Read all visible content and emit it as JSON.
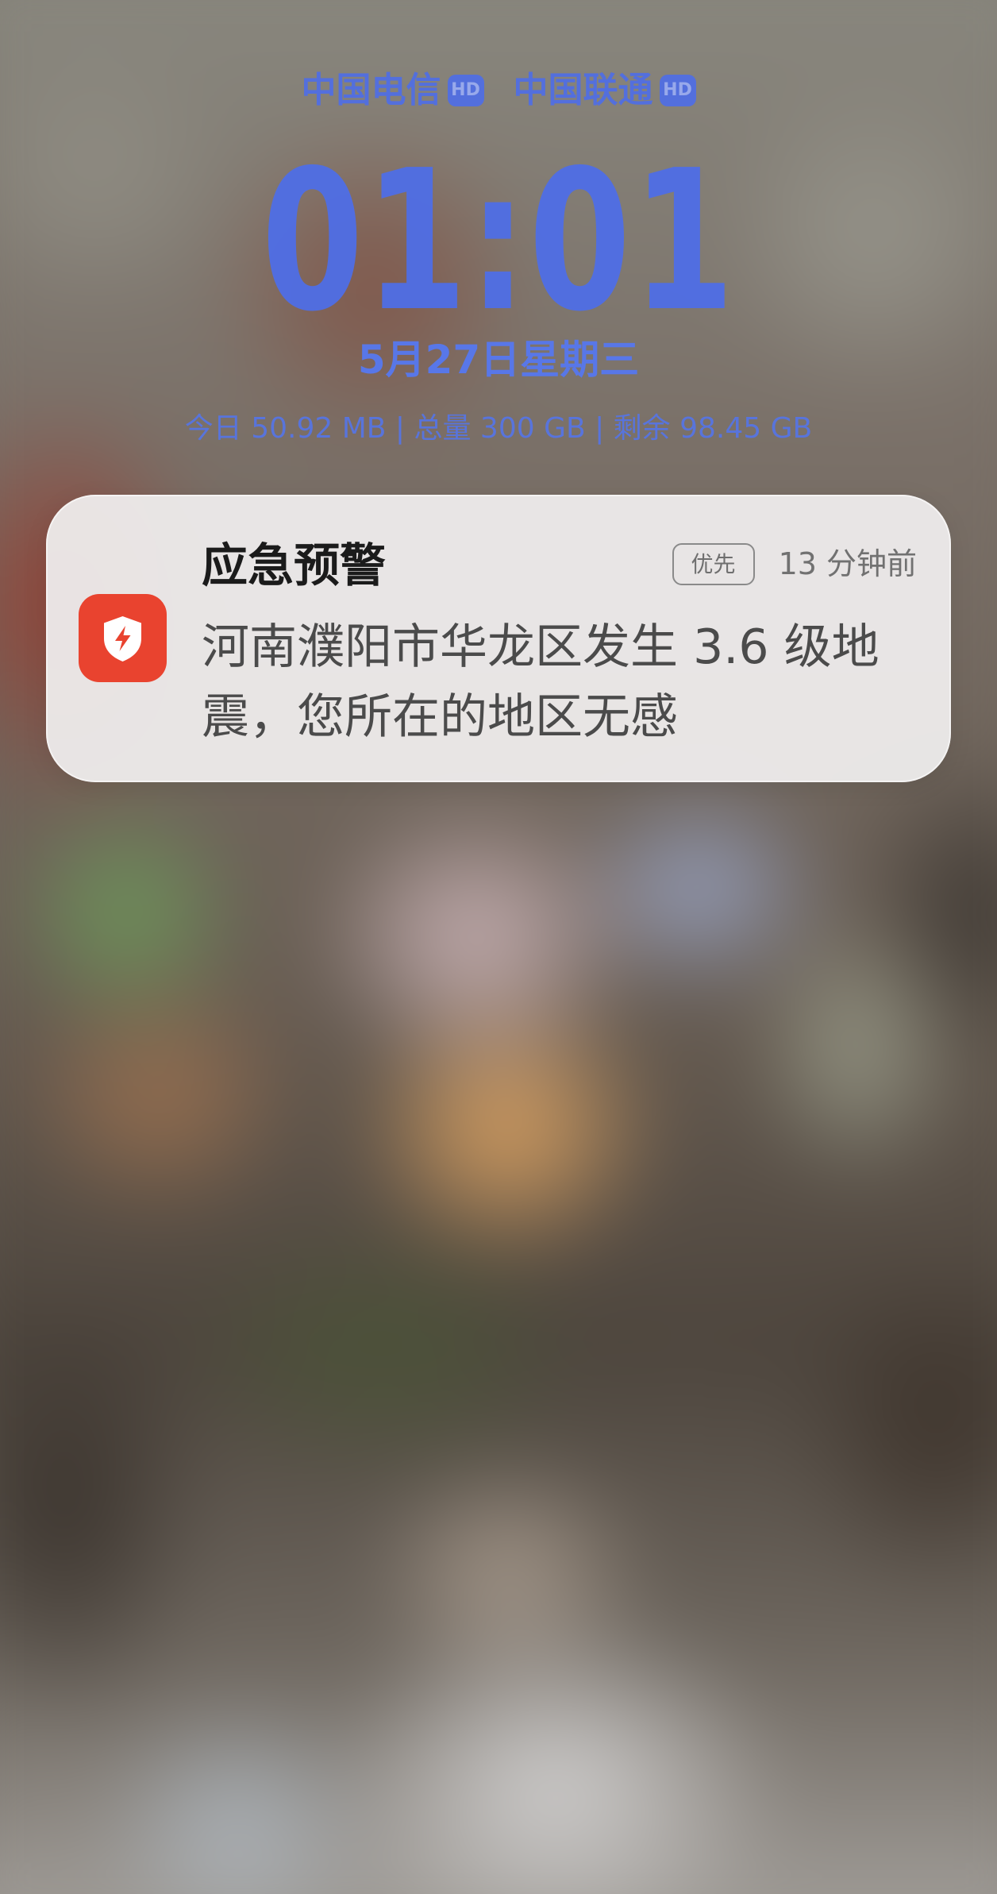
{
  "status": {
    "carriers": [
      {
        "name": "中国电信",
        "badge": "HD"
      },
      {
        "name": "中国联通",
        "badge": "HD"
      }
    ]
  },
  "lockscreen": {
    "time": "01:01",
    "date": "5月27日星期三",
    "data_usage": "今日 50.92 MB | 总量 300 GB | 剩余 98.45 GB"
  },
  "notification": {
    "app_icon": "emergency-shield-icon",
    "title": "应急预警",
    "priority_badge": "优先",
    "timestamp": "13 分钟前",
    "body": "河南濮阳市华龙区发生 3.6 级地震，您所在的地区无感"
  },
  "colors": {
    "accent": "#4f6ee6",
    "icon_background": "#e9432f"
  }
}
